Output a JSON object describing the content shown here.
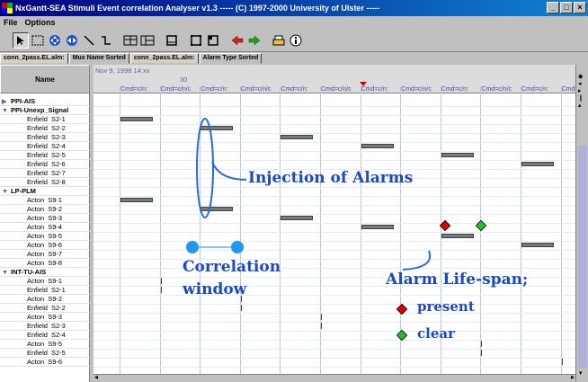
{
  "window": {
    "title": "NxGantt-SEA Stimuli Event correlation Analyser  v1.3          ----- (C) 1997-2000 University of Ulster -----",
    "controls": [
      "_",
      "□",
      "×"
    ]
  },
  "menu": {
    "items": [
      "File",
      "Options"
    ]
  },
  "tabs": [
    {
      "label": "conn_2pass.EL.alm:",
      "active": false
    },
    {
      "label": "Mux Name Sorted",
      "active": true
    },
    {
      "label": "conn_2pass.EL.alm:",
      "active": false
    },
    {
      "label": "Alarm Type Sorted",
      "active": true
    }
  ],
  "left_panel": {
    "header": "Name",
    "rows": [
      {
        "kind": "group",
        "label": "PPI-AIS",
        "expanded": false
      },
      {
        "kind": "group",
        "label": "PPI-Unexp_Signal",
        "expanded": true
      },
      {
        "kind": "child",
        "label": "Enfield",
        "channel": "S2-1"
      },
      {
        "kind": "child",
        "label": "Enfield",
        "channel": "S2-2"
      },
      {
        "kind": "child",
        "label": "Enfield",
        "channel": "S2-3"
      },
      {
        "kind": "child",
        "label": "Enfield",
        "channel": "S2-4"
      },
      {
        "kind": "child",
        "label": "Enfield",
        "channel": "S2-5"
      },
      {
        "kind": "child",
        "label": "Enfield",
        "channel": "S2-6"
      },
      {
        "kind": "child",
        "label": "Enfield",
        "channel": "S2-7"
      },
      {
        "kind": "child",
        "label": "Enfield",
        "channel": "S2-8"
      },
      {
        "kind": "group",
        "label": "LP-PLM",
        "expanded": true
      },
      {
        "kind": "child",
        "label": "Acton",
        "channel": "S9-1"
      },
      {
        "kind": "child",
        "label": "Acton",
        "channel": "S9-2"
      },
      {
        "kind": "child",
        "label": "Acton",
        "channel": "S9-3"
      },
      {
        "kind": "child",
        "label": "Acton",
        "channel": "S9-4"
      },
      {
        "kind": "child",
        "label": "Acton",
        "channel": "S9-5"
      },
      {
        "kind": "child",
        "label": "Acton",
        "channel": "S9-6"
      },
      {
        "kind": "child",
        "label": "Acton",
        "channel": "S9-7"
      },
      {
        "kind": "child",
        "label": "Acton",
        "channel": "S9-8"
      },
      {
        "kind": "group",
        "label": "INT-TU-AIS",
        "expanded": true
      },
      {
        "kind": "child",
        "label": "Acton",
        "channel": "S9-1"
      },
      {
        "kind": "child",
        "label": "Enfield",
        "channel": "S2-1"
      },
      {
        "kind": "child",
        "label": "Acton",
        "channel": "S9-2"
      },
      {
        "kind": "child",
        "label": "Enfield",
        "channel": "S2-2"
      },
      {
        "kind": "child",
        "label": "Acton",
        "channel": "S9-3"
      },
      {
        "kind": "child",
        "label": "Enfield",
        "channel": "S2-3"
      },
      {
        "kind": "child",
        "label": "Enfield",
        "channel": "S2-4"
      },
      {
        "kind": "child",
        "label": "Acton",
        "channel": "S9-5"
      },
      {
        "kind": "child",
        "label": "Enfield",
        "channel": "S2-5"
      },
      {
        "kind": "child",
        "label": "Acton",
        "channel": "S9-6"
      }
    ]
  },
  "timeline": {
    "date": "Nov 9, 1998 14:xx",
    "tick": "30",
    "column_labels": [
      "Cmd=c/n:",
      "Cmd=c/n/c",
      "Cmd=c/n:",
      "Cmd=c/n/c",
      "Cmd=c/n:",
      "Cmd=c/n/c",
      "Cmd=c/n:",
      "Cmd=c/n/c",
      "Cmd=c/n:",
      "Cmd=c/n/c",
      "Cmd=c/n:",
      "Cmd=c/n/"
    ],
    "events": [
      {
        "row": 2,
        "col": 0,
        "kind": "bar"
      },
      {
        "row": 3,
        "col": 2,
        "kind": "bar"
      },
      {
        "row": 4,
        "col": 4,
        "kind": "bar"
      },
      {
        "row": 5,
        "col": 6,
        "kind": "bar"
      },
      {
        "row": 6,
        "col": 8,
        "kind": "bar"
      },
      {
        "row": 7,
        "col": 10,
        "kind": "bar"
      },
      {
        "row": 11,
        "col": 0,
        "kind": "bar"
      },
      {
        "row": 12,
        "col": 2,
        "kind": "bar"
      },
      {
        "row": 13,
        "col": 4,
        "kind": "bar"
      },
      {
        "row": 14,
        "col": 6,
        "kind": "bar"
      },
      {
        "row": 15,
        "col": 8,
        "kind": "bar"
      },
      {
        "row": 16,
        "col": 10,
        "kind": "bar"
      },
      {
        "row": 20,
        "col": 1,
        "kind": "tick"
      },
      {
        "row": 21,
        "col": 1,
        "kind": "tick"
      },
      {
        "row": 22,
        "col": 3,
        "kind": "tick"
      },
      {
        "row": 23,
        "col": 3,
        "kind": "tick"
      },
      {
        "row": 24,
        "col": 5,
        "kind": "tick"
      },
      {
        "row": 25,
        "col": 5,
        "kind": "tick"
      },
      {
        "row": 26,
        "col": 7,
        "kind": "tick"
      },
      {
        "row": 27,
        "col": 9,
        "kind": "tick"
      },
      {
        "row": 28,
        "col": 9,
        "kind": "tick"
      },
      {
        "row": 29,
        "col": 11,
        "kind": "tick"
      }
    ]
  },
  "annotations": {
    "injection": "Injection of Alarms",
    "correlation_line1": "Correlation",
    "correlation_line2": "window",
    "lifespan": "Alarm Life-span;",
    "present": "present",
    "clear": "clear"
  },
  "colors": {
    "annotation": "#1a48c8",
    "present_marker": "#e00000",
    "clear_marker": "#20c020",
    "window_marker": "#2196f3"
  }
}
